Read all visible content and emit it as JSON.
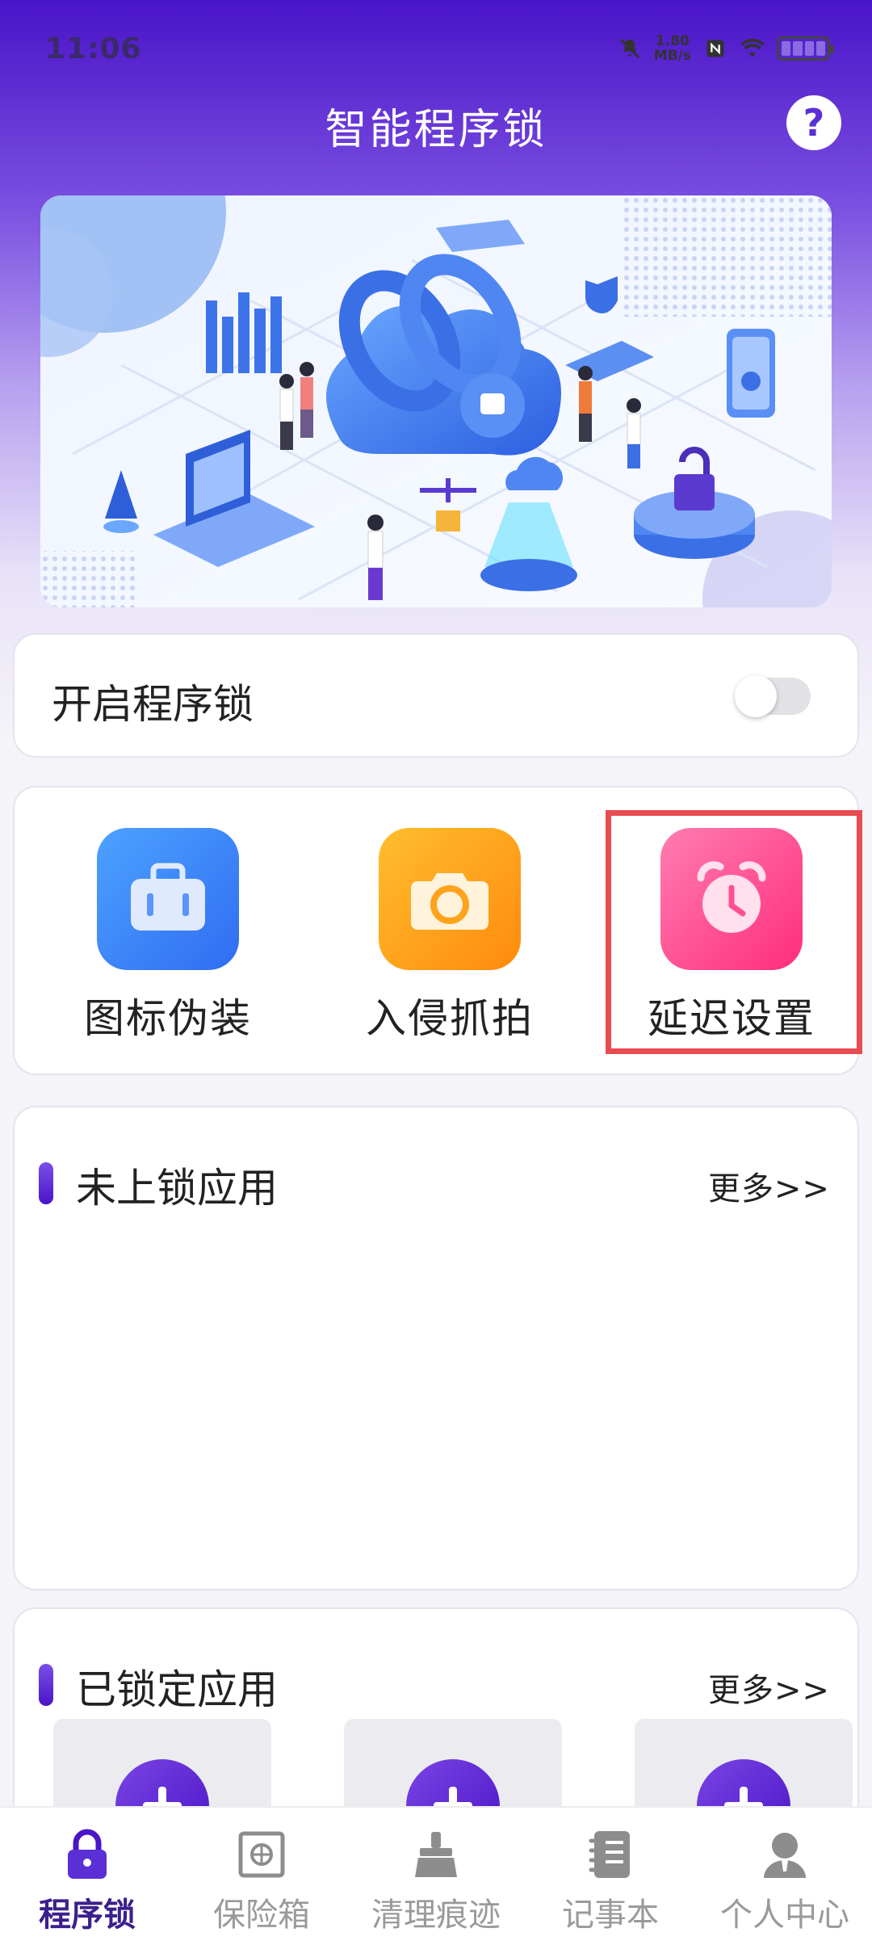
{
  "status_bar": {
    "time": "11:06",
    "net_speed_value": "1.80",
    "net_speed_unit": "MB/s",
    "icons": [
      "mute-icon",
      "nfc-icon",
      "wifi-icon",
      "battery-icon"
    ]
  },
  "header": {
    "title": "智能程序锁",
    "help_label": "?"
  },
  "banner": {
    "illustration": "smart-lock-isometric-illustration"
  },
  "lock_toggle": {
    "label": "开启程序锁",
    "enabled": false
  },
  "features": [
    {
      "label": "图标伪装",
      "icon": "briefcase-icon",
      "color": "#3b82f6"
    },
    {
      "label": "入侵抓拍",
      "icon": "camera-icon",
      "color": "#ff9c16"
    },
    {
      "label": "延迟设置",
      "icon": "alarm-clock-icon",
      "color": "#ff4f93",
      "highlighted": true
    }
  ],
  "unlocked_apps": {
    "title": "未上锁应用",
    "more_label": "更多>>"
  },
  "locked_apps": {
    "title": "已锁定应用",
    "more_label": "更多>>",
    "add_tiles": 3
  },
  "bottom_nav": [
    {
      "label": "程序锁",
      "icon": "lock-icon",
      "active": true
    },
    {
      "label": "保险箱",
      "icon": "safe-icon",
      "active": false
    },
    {
      "label": "清理痕迹",
      "icon": "broom-icon",
      "active": false
    },
    {
      "label": "记事本",
      "icon": "notebook-icon",
      "active": false
    },
    {
      "label": "个人中心",
      "icon": "user-icon",
      "active": false
    }
  ],
  "colors": {
    "primary": "#4a14c8",
    "highlight_border": "#e84b50"
  }
}
